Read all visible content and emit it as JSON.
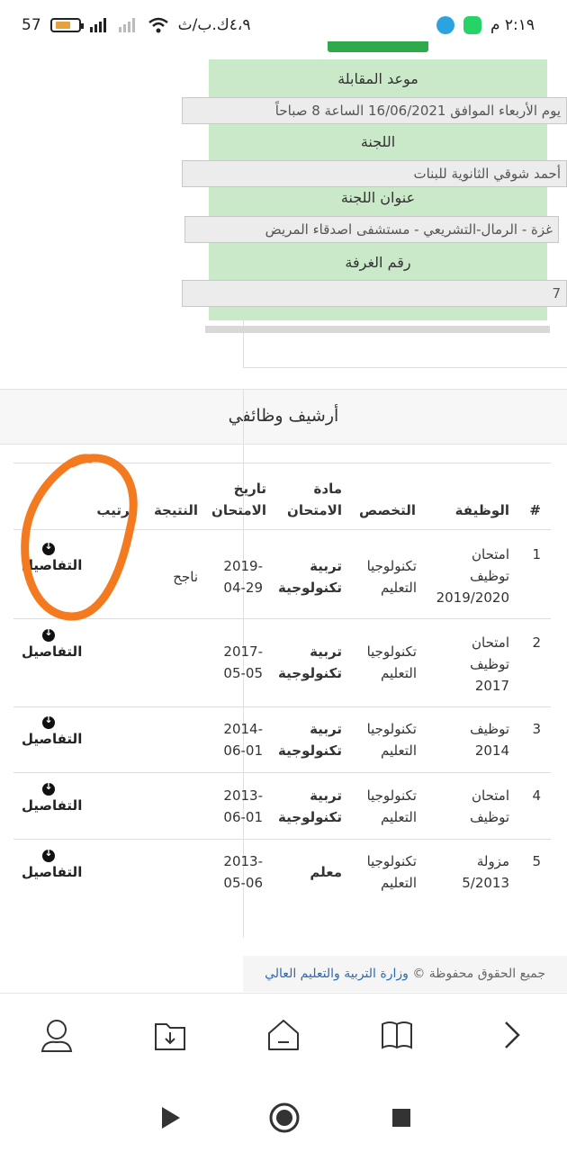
{
  "status_bar": {
    "time": "٢:١٩ م",
    "speed": "٤،٩ك.ب/ث",
    "battery": "57",
    "apps": [
      "telegram-icon",
      "whatsapp-icon"
    ]
  },
  "info_card": {
    "fields": [
      {
        "label": "موعد المقابلة",
        "value": "يوم الأربعاء الموافق 16/06/2021 الساعة 8 صباحاً"
      },
      {
        "label": "اللجنة",
        "value": "أحمد شوقي الثانوية للبنات"
      },
      {
        "label": "عنوان اللجنة",
        "value": "غزة - الرمال-التشريعي - مستشفى اصدقاء المريض"
      },
      {
        "label": "رقم الغرفة",
        "value": "7"
      }
    ],
    "accent": "#c9e9c9"
  },
  "archive": {
    "title": "أرشيف وظائفي",
    "headers": {
      "num": "#",
      "job": "الوظيفة",
      "specialty": "التخصص",
      "subject": "مادة الامتحان",
      "date": "تاريخ الامتحان",
      "result": "النتيجة",
      "rank": "ترتيب"
    },
    "rows": [
      {
        "num": "1",
        "job": "امتحان توظيف 2019/2020",
        "specialty": "تكنولوجيا التعليم",
        "subject": "تربية تكنولوجية",
        "date": "2019-04-29",
        "result": "ناجح",
        "rank": "-",
        "details": "التفاصيل"
      },
      {
        "num": "2",
        "job": "امتحان توظيف 2017",
        "specialty": "تكنولوجيا التعليم",
        "subject": "تربية تكنولوجية",
        "date": "2017-05-05",
        "result": "",
        "rank": "",
        "details": "التفاصيل"
      },
      {
        "num": "3",
        "job": "توظيف 2014",
        "specialty": "تكنولوجيا التعليم",
        "subject": "تربية تكنولوجية",
        "date": "2014-06-01",
        "result": "",
        "rank": "",
        "details": "التفاصيل"
      },
      {
        "num": "4",
        "job": "امتحان توظيف",
        "specialty": "تكنولوجيا التعليم",
        "subject": "تربية تكنولوجية",
        "date": "2013-06-01",
        "result": "",
        "rank": "",
        "details": "التفاصيل"
      },
      {
        "num": "5",
        "job": "مزولة 5/2013",
        "specialty": "تكنولوجيا التعليم",
        "subject": "معلم",
        "date": "2013-05-06",
        "result": "",
        "rank": "",
        "details": "التفاصيل"
      }
    ]
  },
  "footer": {
    "rights": "جميع الحقوق محفوظة ©",
    "org": "وزارة التربية والتعليم العالي"
  },
  "toolbar": {
    "items": [
      "chevron-right-icon",
      "book-icon",
      "home-icon",
      "downloads-icon",
      "profile-icon"
    ]
  },
  "navbar": {
    "items": [
      "back-icon",
      "home-circle-icon",
      "recents-icon"
    ]
  },
  "annotation_color": "#f47a20"
}
